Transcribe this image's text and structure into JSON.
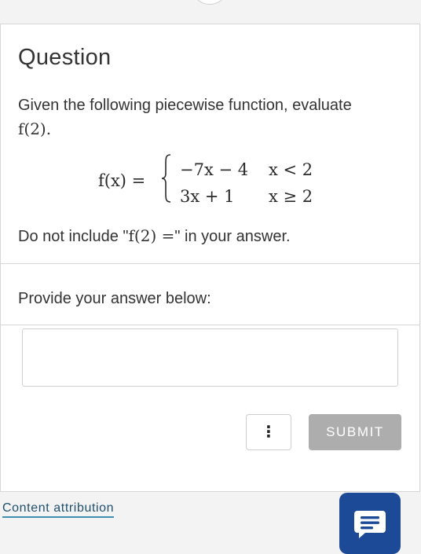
{
  "question": {
    "title": "Question",
    "prompt_text": "Given the following piecewise function, evaluate",
    "prompt_math": "f(2).",
    "piecewise": {
      "lhs": "f(x) =",
      "rows": [
        {
          "expr": "−7x − 4",
          "cond": "x < 2"
        },
        {
          "expr": "3x + 1",
          "cond": "x ≥ 2"
        }
      ]
    },
    "note_before": "Do not include \"",
    "note_math": "f(2) =",
    "note_after": "\" in your answer."
  },
  "answer": {
    "label": "Provide your answer below:",
    "input_value": "",
    "input_placeholder": ""
  },
  "actions": {
    "more_label": "⋮",
    "submit_label": "SUBMIT"
  },
  "footer": {
    "attribution_label": "Content attribution"
  },
  "icons": {
    "chat": "chat-bubble-icon",
    "more": "vertical-dots-icon"
  },
  "colors": {
    "submit_bg": "#adadad",
    "chat_bg": "#1d4a96",
    "link": "#1f4f6e",
    "link_underline": "#3f8fb0"
  }
}
